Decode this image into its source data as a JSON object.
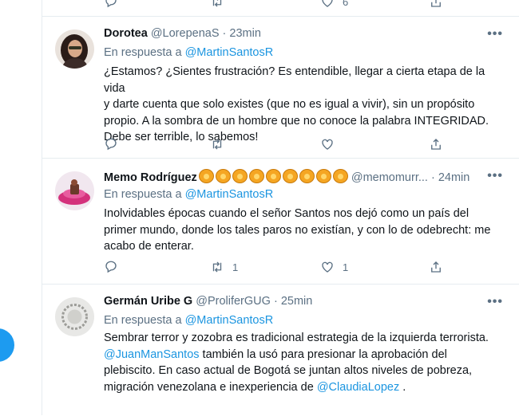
{
  "top_actions": {
    "like_count": "6"
  },
  "tweets": [
    {
      "name": "Dorotea",
      "handle": "@LorepenaS",
      "time": "23min",
      "reply_prefix": "En respuesta a",
      "reply_to": "@MartinSantosR",
      "line1": "¿Estamos? ¿Sientes frustración? Es entendible, llegar a cierta etapa de la vida",
      "line2": "y darte cuenta que solo existes (que no es igual a vivir), sin un propósito",
      "line3": "propio. A la sombra de un hombre que no conoce la palabra INTEGRIDAD.",
      "line4": "Debe ser terrible, lo sabemos!",
      "retweets": "",
      "likes": ""
    },
    {
      "name": "Memo Rodríguez",
      "handle": "@memomurr...",
      "time": "24min",
      "reply_prefix": "En respuesta a",
      "reply_to": "@MartinSantosR",
      "line1": "Inolvidables épocas cuando el señor Santos nos dejó como un país del",
      "line2": "primer mundo, donde los tales paros no existían, y con lo de odebrecht: me",
      "line3": "acabo de enterar.",
      "retweets": "1",
      "likes": "1"
    },
    {
      "name": "Germán Uribe G",
      "handle": "@ProliferGUG",
      "time": "25min",
      "reply_prefix": "En respuesta a",
      "reply_to": "@MartinSantosR",
      "line1": "Sembrar terror y zozobra es tradicional estrategia de la izquierda terrorista.",
      "line2_mention": "@JuanManSantos",
      "line2_rest": " también la usó para presionar la aprobación del",
      "line3": "plebiscito. En caso actual de Bogotá se juntan altos niveles de pobreza,",
      "line4_pre": "migración venezolana e inexperiencia de ",
      "line4_mention": "@ClaudiaLopez",
      "line4_post": " ."
    }
  ],
  "colors": {
    "accent": "#1b95e0",
    "muted": "#5b7083",
    "border": "#e6ecf0",
    "fab": "#1d9bf0"
  },
  "icons": [
    "reply-icon",
    "retweet-icon",
    "like-icon",
    "share-icon",
    "more-icon",
    "lion-emoji"
  ]
}
